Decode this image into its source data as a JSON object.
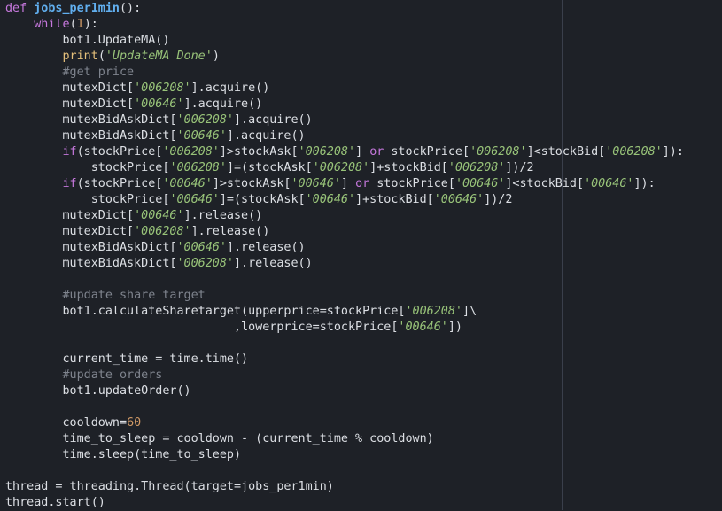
{
  "editor": {
    "colors": {
      "background": "#1e2127",
      "keyword": "#c678dd",
      "function_name": "#61afef",
      "text": "#dcdfe4",
      "string": "#98c379",
      "comment": "#7f848e",
      "number": "#d19a66",
      "builtin": "#e5c07b",
      "ruler": "#3a3f4b"
    },
    "lines": [
      [
        [
          "kw",
          "def "
        ],
        [
          "fn",
          "jobs_per1min"
        ],
        [
          "txt",
          "():"
        ]
      ],
      [
        [
          "txt",
          "    "
        ],
        [
          "kw",
          "while"
        ],
        [
          "txt",
          "("
        ],
        [
          "num",
          "1"
        ],
        [
          "txt",
          "):"
        ]
      ],
      [
        [
          "txt",
          "        bot1.UpdateMA()"
        ]
      ],
      [
        [
          "txt",
          "        "
        ],
        [
          "builtin",
          "print"
        ],
        [
          "txt",
          "("
        ],
        [
          "str",
          "'UpdateMA Done'"
        ],
        [
          "txt",
          ")"
        ]
      ],
      [
        [
          "txt",
          "        "
        ],
        [
          "com",
          "#get price"
        ]
      ],
      [
        [
          "txt",
          "        mutexDict["
        ],
        [
          "str",
          "'006208'"
        ],
        [
          "txt",
          "].acquire()"
        ]
      ],
      [
        [
          "txt",
          "        mutexDict["
        ],
        [
          "str",
          "'00646'"
        ],
        [
          "txt",
          "].acquire()"
        ]
      ],
      [
        [
          "txt",
          "        mutexBidAskDict["
        ],
        [
          "str",
          "'006208'"
        ],
        [
          "txt",
          "].acquire()"
        ]
      ],
      [
        [
          "txt",
          "        mutexBidAskDict["
        ],
        [
          "str",
          "'00646'"
        ],
        [
          "txt",
          "].acquire()"
        ]
      ],
      [
        [
          "txt",
          "        "
        ],
        [
          "kw",
          "if"
        ],
        [
          "txt",
          "(stockPrice["
        ],
        [
          "str",
          "'006208'"
        ],
        [
          "txt",
          "]>stockAsk["
        ],
        [
          "str",
          "'006208'"
        ],
        [
          "txt",
          "] "
        ],
        [
          "kw",
          "or"
        ],
        [
          "txt",
          " stockPrice["
        ],
        [
          "str",
          "'006208'"
        ],
        [
          "txt",
          "]<stockBid["
        ],
        [
          "str",
          "'006208'"
        ],
        [
          "txt",
          "]):"
        ]
      ],
      [
        [
          "txt",
          "            stockPrice["
        ],
        [
          "str",
          "'006208'"
        ],
        [
          "txt",
          "]=(stockAsk["
        ],
        [
          "str",
          "'006208'"
        ],
        [
          "txt",
          "]+stockBid["
        ],
        [
          "str",
          "'006208'"
        ],
        [
          "txt",
          "])/2"
        ]
      ],
      [
        [
          "txt",
          "        "
        ],
        [
          "kw",
          "if"
        ],
        [
          "txt",
          "(stockPrice["
        ],
        [
          "str",
          "'00646'"
        ],
        [
          "txt",
          "]>stockAsk["
        ],
        [
          "str",
          "'00646'"
        ],
        [
          "txt",
          "] "
        ],
        [
          "kw",
          "or"
        ],
        [
          "txt",
          " stockPrice["
        ],
        [
          "str",
          "'00646'"
        ],
        [
          "txt",
          "]<stockBid["
        ],
        [
          "str",
          "'00646'"
        ],
        [
          "txt",
          "]):"
        ]
      ],
      [
        [
          "txt",
          "            stockPrice["
        ],
        [
          "str",
          "'00646'"
        ],
        [
          "txt",
          "]=(stockAsk["
        ],
        [
          "str",
          "'00646'"
        ],
        [
          "txt",
          "]+stockBid["
        ],
        [
          "str",
          "'00646'"
        ],
        [
          "txt",
          "])/2"
        ]
      ],
      [
        [
          "txt",
          "        mutexDict["
        ],
        [
          "str",
          "'00646'"
        ],
        [
          "txt",
          "].release()"
        ]
      ],
      [
        [
          "txt",
          "        mutexDict["
        ],
        [
          "str",
          "'006208'"
        ],
        [
          "txt",
          "].release()"
        ]
      ],
      [
        [
          "txt",
          "        mutexBidAskDict["
        ],
        [
          "str",
          "'00646'"
        ],
        [
          "txt",
          "].release()"
        ]
      ],
      [
        [
          "txt",
          "        mutexBidAskDict["
        ],
        [
          "str",
          "'006208'"
        ],
        [
          "txt",
          "].release()"
        ]
      ],
      [],
      [
        [
          "txt",
          "        "
        ],
        [
          "com",
          "#update share target"
        ]
      ],
      [
        [
          "txt",
          "        bot1.calculateSharetarget(upperprice=stockPrice["
        ],
        [
          "str",
          "'006208'"
        ],
        [
          "txt",
          "]\\"
        ]
      ],
      [
        [
          "txt",
          "                                ,lowerprice=stockPrice["
        ],
        [
          "str",
          "'00646'"
        ],
        [
          "txt",
          "])"
        ]
      ],
      [],
      [
        [
          "txt",
          "        current_time = time.time()"
        ]
      ],
      [
        [
          "txt",
          "        "
        ],
        [
          "com",
          "#update orders"
        ]
      ],
      [
        [
          "txt",
          "        bot1.updateOrder()"
        ]
      ],
      [],
      [
        [
          "txt",
          "        cooldown="
        ],
        [
          "num",
          "60"
        ]
      ],
      [
        [
          "txt",
          "        time_to_sleep = cooldown - (current_time % cooldown)"
        ]
      ],
      [
        [
          "txt",
          "        time.sleep(time_to_sleep)"
        ]
      ],
      [],
      [
        [
          "txt",
          "thread = threading.Thread(target=jobs_per1min)"
        ]
      ],
      [
        [
          "txt",
          "thread.start()"
        ]
      ]
    ]
  }
}
